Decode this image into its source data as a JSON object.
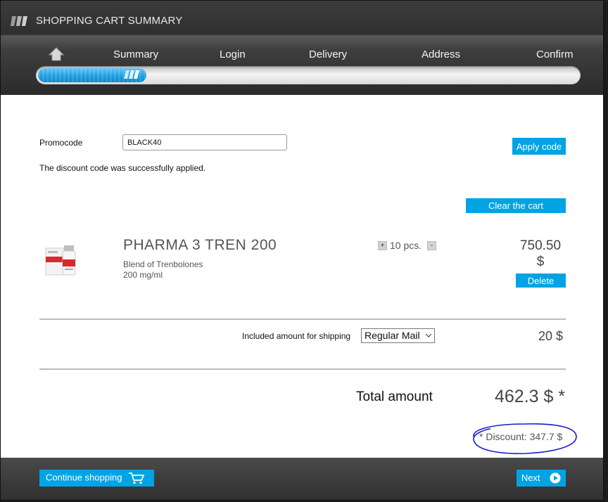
{
  "header": {
    "title": "SHOPPING CART SUMMARY",
    "steps": [
      "Summary",
      "Login",
      "Delivery",
      "Address",
      "Confirm"
    ],
    "progress_percent": 20
  },
  "promo": {
    "label": "Promocode",
    "value": "BLACK40",
    "apply_label": "Apply code",
    "success_message": "The discount code was successfully applied."
  },
  "cart": {
    "clear_label": "Clear the cart",
    "item": {
      "name": "PHARMA 3 TREN 200",
      "description_line1": "Blend of Trenbolones",
      "description_line2": "200 mg/ml",
      "quantity_text": "10 pcs.",
      "plus_label": "+",
      "minus_label": "-",
      "price_amount": "750.50",
      "price_currency": "$",
      "delete_label": "Delete"
    }
  },
  "shipping": {
    "label": "Included amount for shipping",
    "selected": "Regular Mail",
    "price": "20 $"
  },
  "totals": {
    "label": "Total amount",
    "value": "462.3 $ *",
    "discount": "* Discount: 347.7 $"
  },
  "footer": {
    "continue_label": "Continue shopping",
    "next_label": "Next"
  },
  "colors": {
    "accent": "#00a4e4",
    "annotation": "#1a1acc"
  }
}
